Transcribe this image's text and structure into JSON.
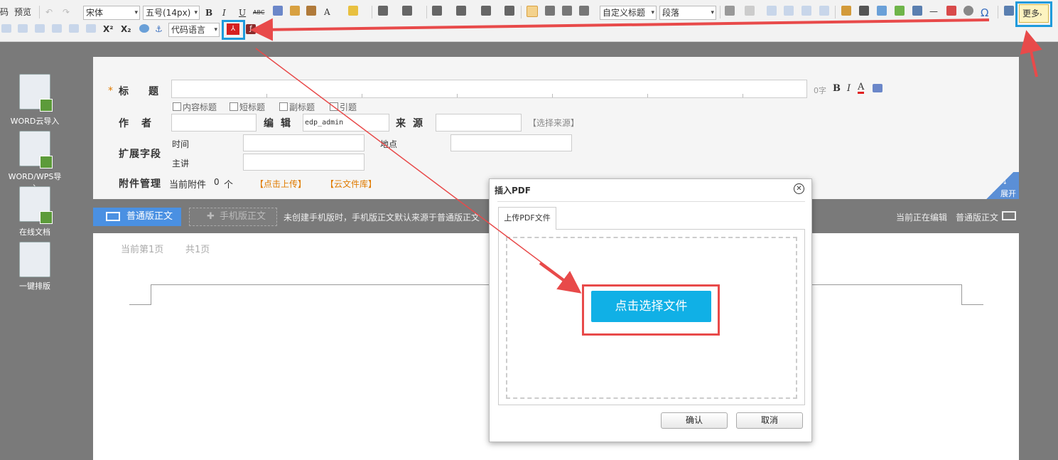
{
  "toolbar": {
    "code_label": "码",
    "preview_label": "预览",
    "font_family": "宋体",
    "font_size": "五号(14px)",
    "bold": "B",
    "italic": "I",
    "underline": "U",
    "strike": "ABC",
    "font_color_glyph": "A",
    "custom_title": "自定义标题",
    "paragraph": "段落",
    "code_language": "代码语言",
    "superscript": "X²",
    "subscript": "X₂",
    "omega": "Ω",
    "more_label": "更多"
  },
  "sidebar": {
    "items": [
      {
        "label": "WORD云导入"
      },
      {
        "label": "WORD/WPS导入"
      },
      {
        "label": "在线文档"
      },
      {
        "label": "一键排版"
      }
    ]
  },
  "form": {
    "required_mark": "*",
    "title_label": "标题",
    "title_count": "0字",
    "fmt_bold": "B",
    "fmt_italic": "I",
    "fmt_color": "A",
    "options": [
      "内容标题",
      "短标题",
      "副标题",
      "引题"
    ],
    "author_label": "作者",
    "editor_label": "编辑",
    "editor_value": "edp_admin",
    "source_label": "来源",
    "select_source": "【选择来源】",
    "ext_label": "扩展字段",
    "time_label": "时间",
    "place_label": "地点",
    "speaker_label": "主讲",
    "attach_label": "附件管理",
    "attach_current": "当前附件",
    "attach_count": "0",
    "attach_unit": "个",
    "upload_link": "【点击上传】",
    "cloud_link": "【云文件库】",
    "expand": "展开"
  },
  "tabs": {
    "normal": "普通版正文",
    "mobile": "手机版正文",
    "hint": "未创建手机版时，手机版正文默认来源于普通版正文",
    "editing_prefix": "当前正在编辑",
    "editing_value": "普通版正文"
  },
  "editor": {
    "current_page": "当前第1页",
    "total_pages": "共1页"
  },
  "dialog": {
    "title": "插入PDF",
    "tab_label": "上传PDF文件",
    "choose_file": "点击选择文件",
    "confirm": "确认",
    "cancel": "取消"
  },
  "colors": {
    "accent_blue": "#4a90e2",
    "upload_button": "#10b0e6",
    "highlight_red": "#e84a4a",
    "highlight_blue": "#1e9bdc",
    "link_orange": "#e07b00"
  }
}
